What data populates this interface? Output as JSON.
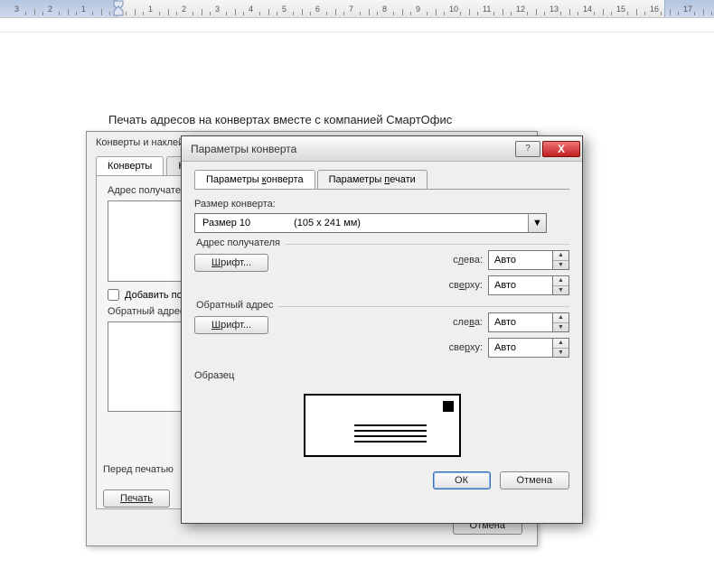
{
  "document": {
    "heading": "Печать адресов на конвертах вместе с компанией СмартОфис"
  },
  "dialog_back": {
    "title": "Конверты и наклейки",
    "tabs": {
      "envelopes": "Конверты",
      "labels": "Наклейки"
    },
    "recipient_label": "Адрес получателя",
    "add_postage_checkbox": "Добавить почтовую",
    "return_address_label": "Обратный адрес",
    "before_print_label": "Перед печатью",
    "print_button": "Печать",
    "cancel_button": "Отмена"
  },
  "dialog_front": {
    "title": "Параметры конверта",
    "titlebar": {
      "help": "?",
      "close": "X"
    },
    "tabs": {
      "options": {
        "pre": "Параметры ",
        "u": "к",
        "post": "онверта"
      },
      "printing": {
        "pre": "Параметры  ",
        "u": "п",
        "post": "ечати"
      }
    },
    "size_label": "Размер конверта:",
    "size_select": {
      "value": "Размер 10",
      "dim": "(105 х 241 мм)"
    },
    "groups": {
      "recipient": "Адрес получателя",
      "return": "Обратный адрес"
    },
    "font_button": {
      "u": "Ш",
      "rest": "рифт..."
    },
    "pos": {
      "left": {
        "pre": "с",
        "u": "л",
        "post": "ева:"
      },
      "top": {
        "pre": "св",
        "u": "е",
        "post": "рху:"
      },
      "left2": {
        "pre": "сле",
        "u": "в",
        "post": "а:"
      },
      "top2": {
        "pre": "све",
        "u": "р",
        "post": "ху:"
      },
      "auto": "Авто"
    },
    "preview_label": "Образец",
    "ok_button": "ОК",
    "cancel_button": "Отмена"
  }
}
